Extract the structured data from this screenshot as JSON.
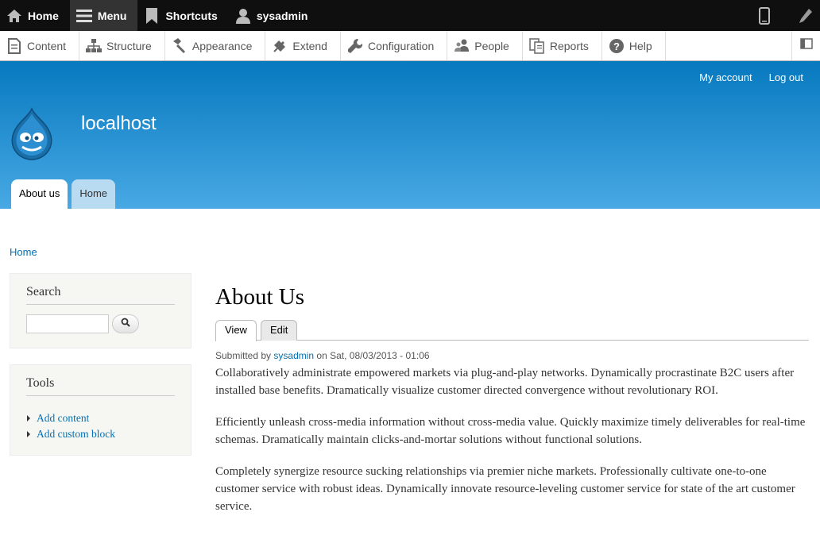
{
  "toolbar": {
    "home_label": "Home",
    "menu_label": "Menu",
    "shortcuts_label": "Shortcuts",
    "user_label": "sysadmin"
  },
  "tray": {
    "items": [
      "Content",
      "Structure",
      "Appearance",
      "Extend",
      "Configuration",
      "People",
      "Reports",
      "Help"
    ]
  },
  "header": {
    "secondary_menu": [
      "My account",
      "Log out"
    ],
    "site_name": "localhost",
    "main_menu": [
      "About us",
      "Home"
    ]
  },
  "breadcrumb": "Home",
  "sidebar": {
    "search_title": "Search",
    "search_value": "",
    "tools_title": "Tools",
    "tools_links": [
      "Add content",
      "Add custom block"
    ]
  },
  "node": {
    "title": "About Us",
    "tabs": [
      "View",
      "Edit"
    ],
    "submitted_prefix": "Submitted by",
    "author": "sysadmin",
    "submitted_suffix": "on Sat, 08/03/2013 - 01:06",
    "paragraphs": [
      "Collaboratively administrate empowered markets via plug-and-play networks. Dynamically procrastinate B2C users after installed base benefits. Dramatically visualize customer directed convergence without revolutionary ROI.",
      "Efficiently unleash cross-media information without cross-media value. Quickly maximize timely deliverables for real-time schemas. Dramatically maintain clicks-and-mortar solutions without functional solutions.",
      "Completely synergize resource sucking relationships via premier niche markets. Professionally cultivate one-to-one customer service with robust ideas. Dynamically innovate resource-leveling customer service for state of the art customer service."
    ]
  },
  "colors": {
    "toolbar_bg": "#0f0f0f",
    "header_top": "#0779bf",
    "header_bottom": "#48a9e4",
    "link": "#0071b3"
  }
}
